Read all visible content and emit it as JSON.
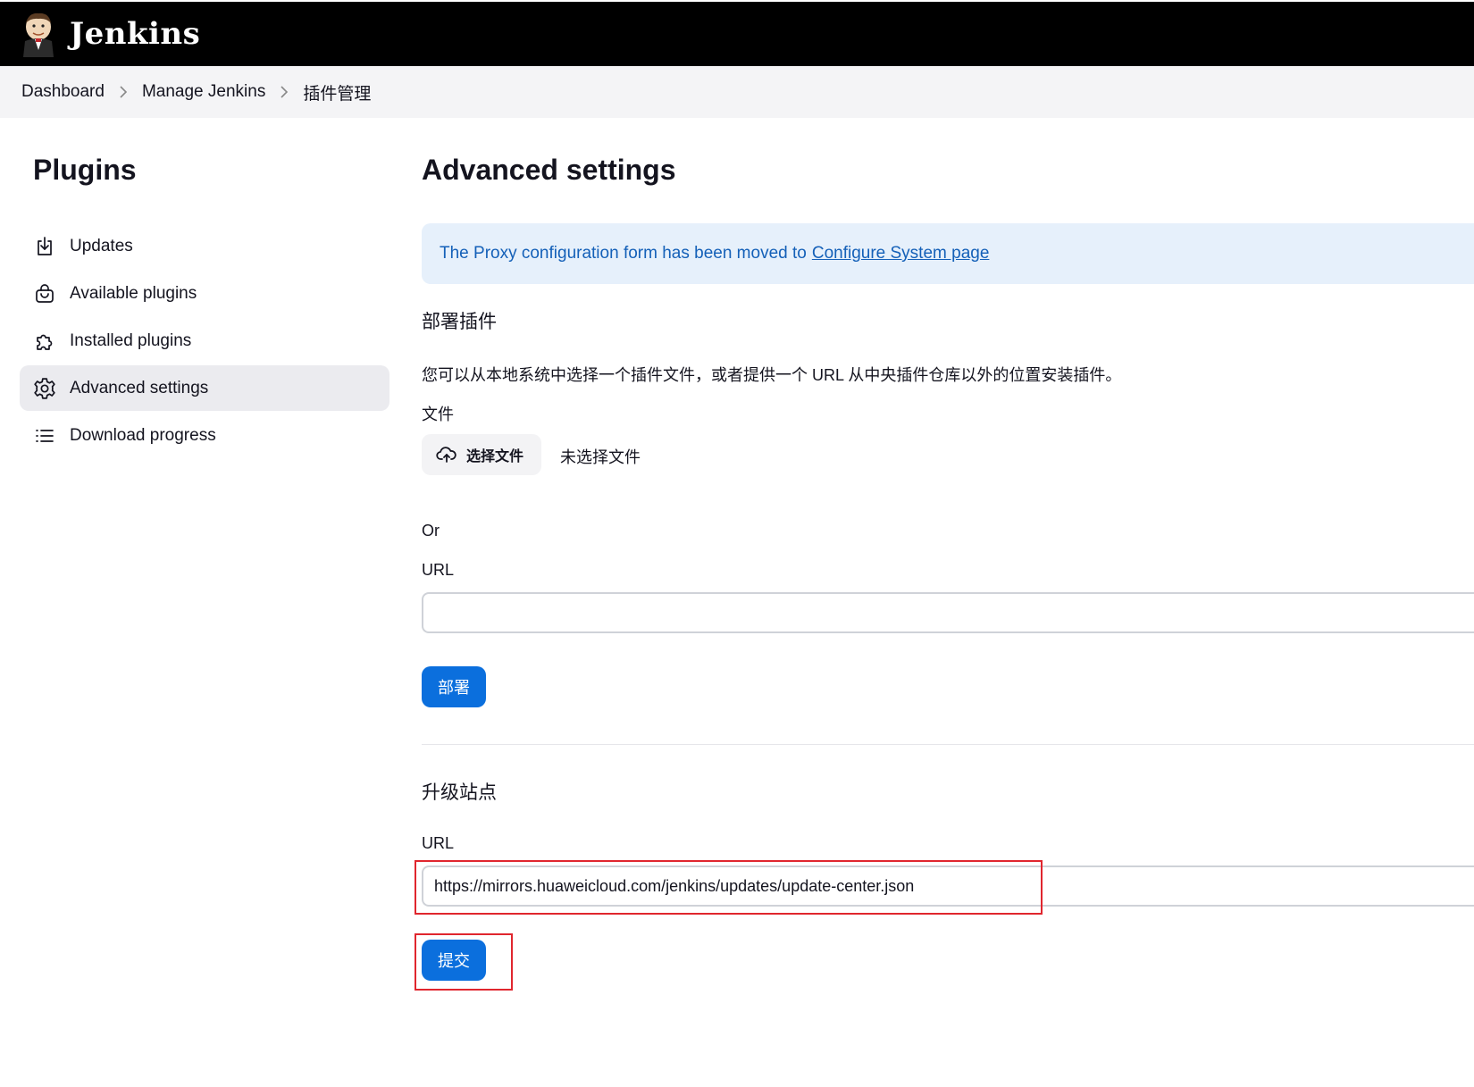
{
  "header": {
    "logo_text": "Jenkins"
  },
  "breadcrumbs": [
    "Dashboard",
    "Manage Jenkins",
    "插件管理"
  ],
  "sidebar": {
    "title": "Plugins",
    "items": [
      {
        "label": "Updates",
        "icon": "download-icon"
      },
      {
        "label": "Available plugins",
        "icon": "shopping-bag-icon"
      },
      {
        "label": "Installed plugins",
        "icon": "puzzle-icon"
      },
      {
        "label": "Advanced settings",
        "icon": "gear-icon",
        "active": true
      },
      {
        "label": "Download progress",
        "icon": "list-icon"
      }
    ]
  },
  "main": {
    "title": "Advanced settings",
    "notice": {
      "text": "The Proxy configuration form has been moved to",
      "link": "Configure System page"
    },
    "deploy": {
      "title": "部署插件",
      "description": "您可以从本地系统中选择一个插件文件，或者提供一个 URL 从中央插件仓库以外的位置安装插件。",
      "file_label": "文件",
      "choose_file": "选择文件",
      "no_file": "未选择文件",
      "or_label": "Or",
      "url_label": "URL",
      "url_value": "",
      "button": "部署"
    },
    "update_site": {
      "title": "升级站点",
      "url_label": "URL",
      "url_value": "https://mirrors.huaweicloud.com/jenkins/updates/update-center.json",
      "button": "提交"
    }
  },
  "colors": {
    "accent": "#0b6fdd",
    "highlight": "#e0262e",
    "notice_bg": "#e6f0fb",
    "notice_text": "#1460b8"
  }
}
